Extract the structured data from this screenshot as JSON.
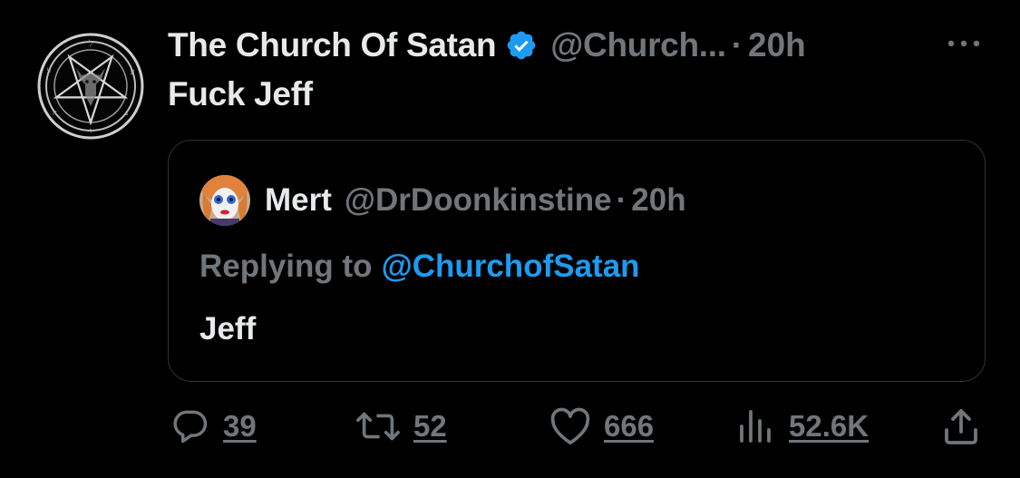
{
  "tweet": {
    "display_name": "The Church Of Satan",
    "verified_icon": "verified-badge-icon",
    "handle": "@Church...",
    "separator": "·",
    "time": "20h",
    "more_icon": "more-horizontal-icon",
    "text": "Fuck Jeff"
  },
  "quote": {
    "display_name": "Mert",
    "handle": "@DrDoonkinstine",
    "separator": "·",
    "time": "20h",
    "replying_label": "Replying to",
    "replying_mention": "@ChurchofSatan",
    "text": "Jeff"
  },
  "actions": {
    "reply": {
      "icon": "reply-icon",
      "count": "39"
    },
    "retweet": {
      "icon": "retweet-icon",
      "count": "52"
    },
    "like": {
      "icon": "heart-icon",
      "count": "666"
    },
    "views": {
      "icon": "views-chart-icon",
      "count": "52.6K"
    },
    "share": {
      "icon": "share-icon"
    }
  },
  "colors": {
    "background": "#000000",
    "primary_text": "#e7e9ea",
    "secondary_text": "#71767b",
    "accent": "#1d9bf0",
    "border": "#2f3336"
  }
}
